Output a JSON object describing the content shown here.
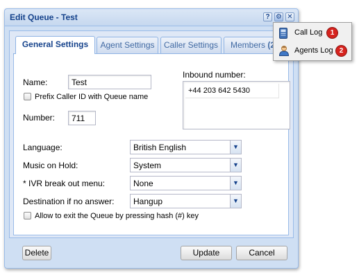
{
  "window": {
    "title": "Edit Queue - Test",
    "tools": [
      "?",
      "⚙",
      "✕"
    ]
  },
  "tabs": [
    {
      "label": "General Settings",
      "active": true
    },
    {
      "label": "Agent Settings",
      "active": false
    },
    {
      "label": "Caller Settings",
      "active": false
    },
    {
      "label": "Members",
      "count": "(2)",
      "active": false
    }
  ],
  "form": {
    "name_label": "Name:",
    "name_value": "Test",
    "prefix_label": "Prefix Caller ID with Queue name",
    "prefix_checked": false,
    "number_label": "Number:",
    "number_value": "711",
    "inbound_label": "Inbound number:",
    "inbound_values": [
      "+44 203 642 5430"
    ],
    "language_label": "Language:",
    "language_value": "British English",
    "moh_label": "Music on Hold:",
    "moh_value": "System",
    "ivr_label": "* IVR break out menu:",
    "ivr_value": "None",
    "dest_label": "Destination if no answer:",
    "dest_value": "Hangup",
    "exit_label": "Allow to exit the Queue by pressing hash (#) key",
    "exit_checked": false
  },
  "footer": {
    "delete_label": "Delete",
    "update_label": "Update",
    "cancel_label": "Cancel"
  },
  "menu": {
    "items": [
      {
        "label": "Call Log",
        "badge": "1",
        "icon": "call-log-icon"
      },
      {
        "label": "Agents Log",
        "badge": "2",
        "icon": "agents-log-icon"
      }
    ]
  },
  "colors": {
    "title": "#15428b",
    "window_bg": "#cfdff3",
    "border": "#99bbe8",
    "badge": "#d6231e"
  }
}
